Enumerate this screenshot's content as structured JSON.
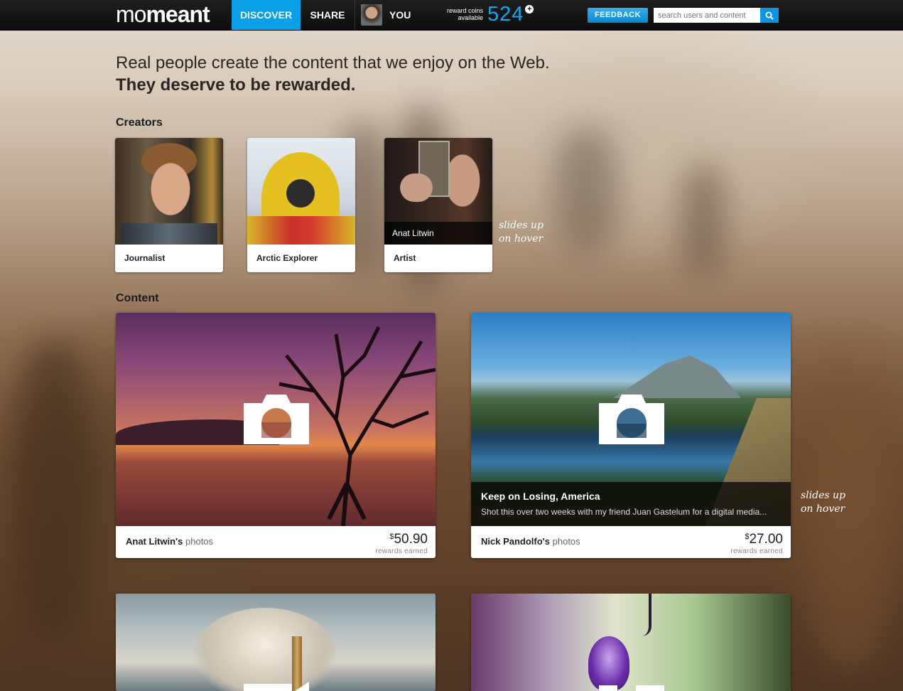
{
  "header": {
    "logo_part1": "mo",
    "logo_part2": "meant",
    "nav": {
      "discover": "DISCOVER",
      "share": "SHARE",
      "you": "YOU"
    },
    "coins": {
      "label_line1": "reward coins",
      "label_line2": "available",
      "value": "524"
    },
    "feedback_label": "FEEDBACK",
    "search_placeholder": "search users and content"
  },
  "hero": {
    "line1": "Real people create the content that we enjoy on the Web.",
    "line2": "They deserve to be rewarded."
  },
  "creators": {
    "title": "Creators",
    "items": [
      {
        "label": "Journalist"
      },
      {
        "label": "Arctic Explorer"
      },
      {
        "label": "Artist",
        "hover_name": "Anat Litwin"
      }
    ],
    "hint_line1": "slides up",
    "hint_line2": "on hover"
  },
  "content": {
    "title": "Content",
    "cards": [
      {
        "owner": "Anat Litwin's",
        "type": "photos",
        "currency": "$",
        "amount": "50.90",
        "earn_label": "rewards earned"
      },
      {
        "owner": "Nick Pandolfo's",
        "type": "photos",
        "currency": "$",
        "amount": "27.00",
        "earn_label": "rewards earned",
        "overlay_title": "Keep on Losing, America",
        "overlay_desc": "Shot this over two weeks with my friend Juan Gastelum for a digital media..."
      }
    ],
    "hint_line1": "slides up",
    "hint_line2": "on hover"
  }
}
